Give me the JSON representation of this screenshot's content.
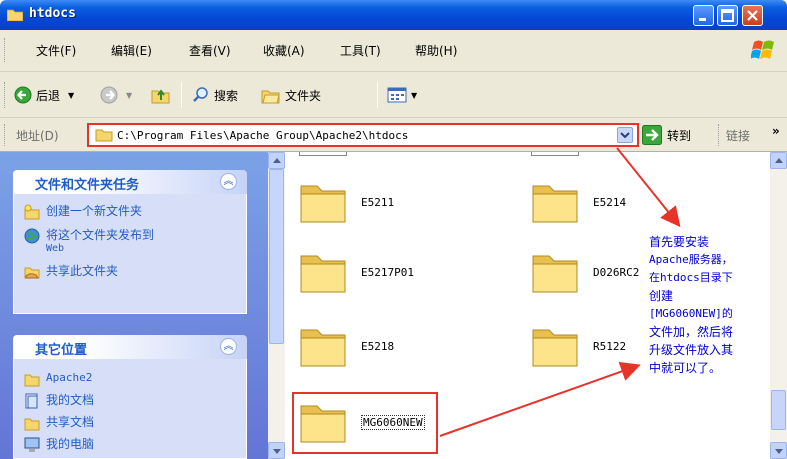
{
  "window": {
    "title": "htdocs"
  },
  "menubar": {
    "items": [
      "文件(F)",
      "编辑(E)",
      "查看(V)",
      "收藏(A)",
      "工具(T)",
      "帮助(H)"
    ]
  },
  "toolbar": {
    "back_label": "后退",
    "search_label": "搜索",
    "folders_label": "文件夹"
  },
  "addressbar": {
    "label": "地址(D)",
    "path": "C:\\Program Files\\Apache Group\\Apache2\\htdocs",
    "go_label": "转到",
    "links_label": "链接"
  },
  "taskpane": {
    "file_tasks": {
      "title": "文件和文件夹任务",
      "items": [
        {
          "label": "创建一个新文件夹",
          "icon": "new-folder-icon"
        },
        {
          "label": "将这个文件夹发布到",
          "sub": "Web",
          "icon": "publish-web-icon"
        },
        {
          "label": "共享此文件夹",
          "icon": "share-folder-icon"
        }
      ]
    },
    "other_places": {
      "title": "其它位置",
      "items": [
        {
          "label": "Apache2",
          "icon": "folder-icon"
        },
        {
          "label": "我的文档",
          "icon": "my-documents-icon"
        },
        {
          "label": "共享文档",
          "icon": "shared-documents-icon"
        },
        {
          "label": "我的电脑",
          "icon": "my-computer-icon"
        }
      ]
    }
  },
  "files": [
    {
      "name": "E5211"
    },
    {
      "name": "E5214"
    },
    {
      "name": "E5217P01"
    },
    {
      "name": "D026RC2"
    },
    {
      "name": "E5218"
    },
    {
      "name": "R5122"
    },
    {
      "name": "MG6060NEW"
    }
  ],
  "annotation": {
    "lines": [
      "首先要安装",
      "Apache服务器，",
      "在htdocs目录下",
      "创建",
      "[MG6060NEW]的",
      "文件加，然后将",
      "升级文件放入其",
      "中就可以了。"
    ]
  },
  "colors": {
    "highlight": "#e8332a",
    "annotation_text": "#0000cc",
    "taskpane_link": "#215dc6"
  }
}
